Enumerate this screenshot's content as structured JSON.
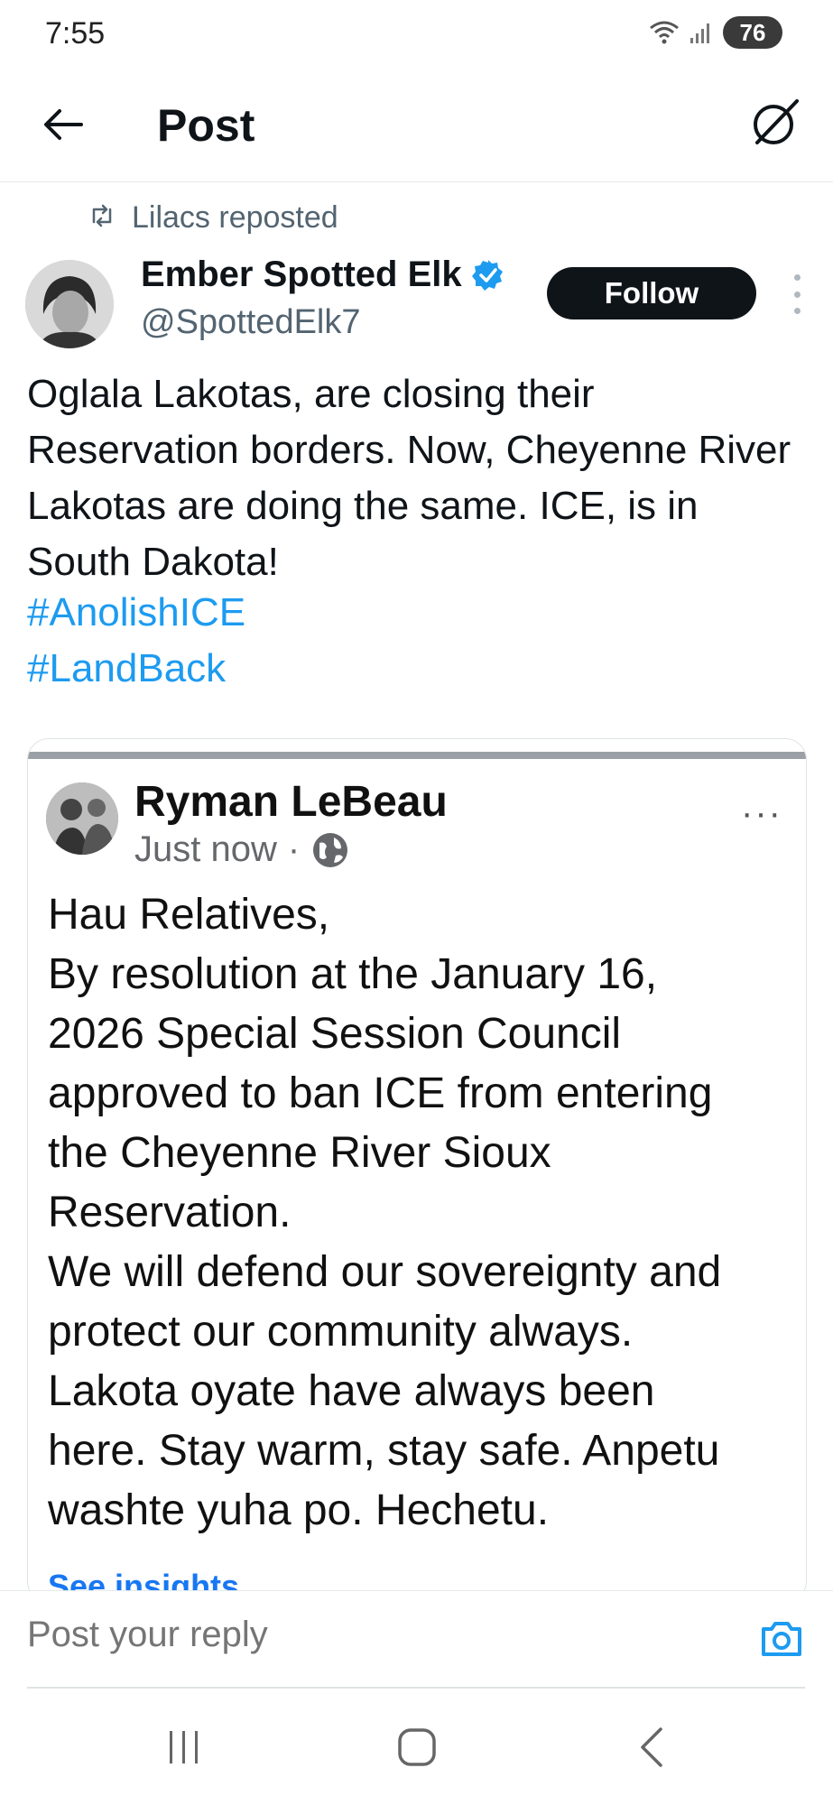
{
  "status_bar": {
    "time": "7:55",
    "battery": "76"
  },
  "header": {
    "title": "Post"
  },
  "repost": {
    "label": "Lilacs reposted"
  },
  "author": {
    "name": "Ember Spotted Elk",
    "handle": "@SpottedElk7",
    "follow_label": "Follow"
  },
  "tweet": {
    "text": "Oglala Lakotas, are closing their Reservation borders. Now, Cheyenne River Lakotas are doing the same. ICE, is in South Dakota!",
    "hashtags": [
      "#AnolishICE",
      "#LandBack"
    ]
  },
  "embedded_post": {
    "name": "Ryman LeBeau",
    "time": "Just now",
    "separator": "·",
    "more": "···",
    "text_lines": [
      "Hau Relatives,",
      "By resolution at the January 16,",
      "2026 Special Session Council",
      "approved to ban ICE from entering",
      "the Cheyenne River Sioux",
      "Reservation.",
      "We will defend our sovereignty and",
      "protect our community always.",
      "Lakota oyate have always been",
      "here. Stay warm, stay safe. Anpetu",
      "washte yuha po. Hechetu."
    ],
    "insights_label": "See insights"
  },
  "reply": {
    "placeholder": "Post your reply"
  },
  "colors": {
    "accent": "#1d9bf0",
    "text": "#0f1419",
    "secondary": "#536471",
    "follow_bg": "#0f1419"
  },
  "icons": [
    "wifi-icon",
    "signal-icon",
    "battery-icon",
    "back-arrow-icon",
    "grok-icon",
    "repost-icon",
    "verified-icon",
    "more-icon",
    "globe-icon",
    "camera-icon",
    "nav-recents-icon",
    "nav-home-icon",
    "nav-back-icon"
  ]
}
